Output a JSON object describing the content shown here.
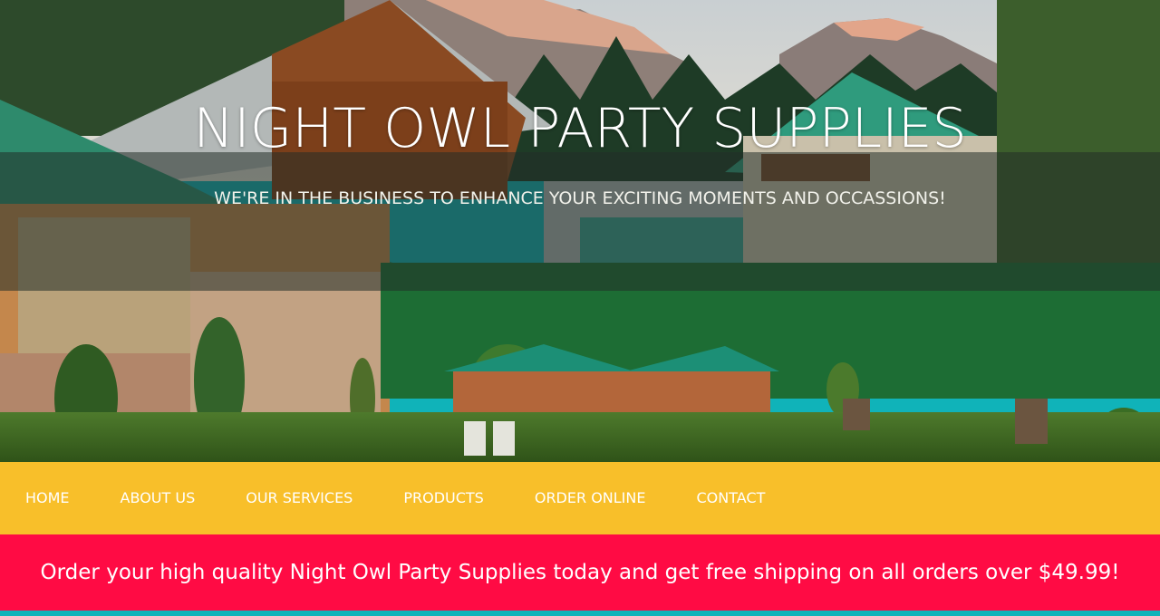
{
  "hero": {
    "title": "NIGHT OWL PARTY SUPPLIES",
    "tagline": "WE'RE IN THE BUSINESS TO ENHANCE YOUR EXCITING MOMENTS AND OCCASSIONS!"
  },
  "nav": {
    "items": [
      {
        "label": "HOME"
      },
      {
        "label": "ABOUT US"
      },
      {
        "label": "OUR SERVICES"
      },
      {
        "label": "PRODUCTS"
      },
      {
        "label": "ORDER ONLINE"
      },
      {
        "label": "CONTACT"
      }
    ]
  },
  "promo": {
    "text": "Order your high quality Night Owl Party Supplies today and get free shipping on all orders over $49.99!"
  },
  "colors": {
    "nav_bg": "#f8bf2a",
    "promo_bg": "#ff0b44",
    "footer_strip": "#10b3b9"
  }
}
